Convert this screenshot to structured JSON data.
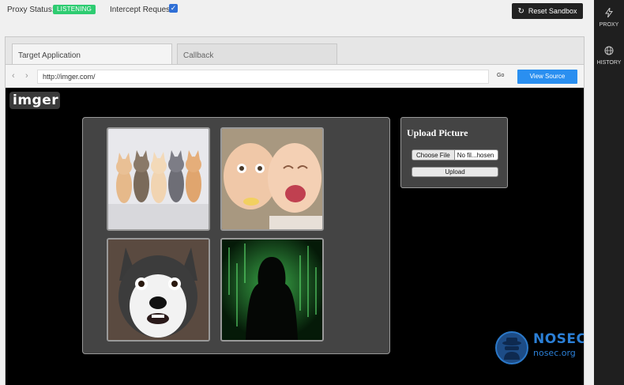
{
  "topbar": {
    "proxy_status_label": "Proxy Status:",
    "proxy_status_value": "LISTENING",
    "intercept_label": "Intercept Requests",
    "intercept_checked": true,
    "reset_label": "Reset Sandbox"
  },
  "rail": {
    "items": [
      {
        "label": "PROXY",
        "icon": "lightning-icon"
      },
      {
        "label": "HISTORY",
        "icon": "globe-icon"
      }
    ]
  },
  "browser": {
    "tabs": [
      {
        "label": "Target Application",
        "active": true
      },
      {
        "label": "Callback",
        "active": false
      }
    ],
    "url": "http://imger.com/",
    "go_label": "Go",
    "view_source_label": "View Source"
  },
  "site": {
    "logo_text": "imger",
    "gallery": [
      {
        "name": "kittens-image",
        "icon": "kittens-photo"
      },
      {
        "name": "babies-image",
        "icon": "crying-babies-photo"
      },
      {
        "name": "dog-image",
        "icon": "scared-husky-photo"
      },
      {
        "name": "hacker-image",
        "icon": "hooded-hacker-photo"
      }
    ],
    "upload": {
      "title": "Upload Picture",
      "choose_file_label": "Choose File",
      "file_name": "No fil...hosen",
      "upload_label": "Upload"
    }
  },
  "watermark": {
    "title": "NOSEC",
    "subtitle": "nosec.org"
  },
  "colors": {
    "accent": "#2a8ff0",
    "listening": "#2ecc71",
    "rail": "#1f1f1f",
    "watermark": "#2b7fd6"
  }
}
